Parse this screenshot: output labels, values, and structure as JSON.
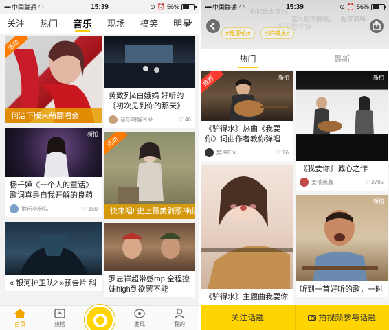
{
  "left": {
    "status": {
      "carrier": "中国联通",
      "time": "15:39",
      "battery": "56%",
      "battery_level": 0.56
    },
    "nav_tabs": [
      {
        "label": "关注",
        "active": false
      },
      {
        "label": "热门",
        "active": false
      },
      {
        "label": "音乐",
        "active": true
      },
      {
        "label": "现场",
        "active": false
      },
      {
        "label": "搞笑",
        "active": false
      },
      {
        "label": "明星",
        "active": false
      }
    ],
    "cards_col_a": [
      {
        "badge": "活动",
        "overlay": "何洁下版来萌翻唱会",
        "title": "",
        "author": "",
        "likes": ""
      },
      {
        "badge": "",
        "overlay": "",
        "title": "杨千嬅《一个人的童话》歌词真是自我开解的良药",
        "author": "港乐小分队",
        "likes": "150"
      },
      {
        "badge": "",
        "overlay": "",
        "title": "« 银河护卫队2 »预告片 科",
        "author": "",
        "likes": ""
      }
    ],
    "cards_col_b": [
      {
        "badge": "",
        "overlay": "",
        "title": "黄致列&白娥娟 好听的《初次见到你的那天》",
        "author": "音乐嗨醒耳朵",
        "likes": "46"
      },
      {
        "badge": "活动",
        "overlay": "快来唱! 史上最美剥葱神曲",
        "title": "",
        "author": "",
        "likes": ""
      },
      {
        "badge": "",
        "overlay": "",
        "title": "罗志祥超带感rap 全程撩妹high到欲罢不能",
        "author": "",
        "likes": ""
      }
    ],
    "tabbar": [
      {
        "label": "首页",
        "icon": "home-icon",
        "active": true
      },
      {
        "label": "热榜",
        "icon": "hot-list-icon",
        "active": false
      },
      {
        "label": "",
        "icon": "record-icon",
        "active": false
      },
      {
        "label": "发现",
        "icon": "discover-icon",
        "active": false
      },
      {
        "label": "我的",
        "icon": "profile-icon",
        "active": false
      }
    ]
  },
  "right": {
    "status": {
      "carrier": "中国联通",
      "time": "15:39",
      "battery": "56%",
      "battery_level": 0.56
    },
    "header": {
      "bg_line1": "你能给大家讨",
      "bg_line2": "这么暖的情歌，一起来演绎~",
      "title": "#我要你#",
      "tags": [
        "#我要你#",
        "#驴得水#"
      ]
    },
    "subtabs": [
      {
        "label": "热门",
        "active": true
      },
      {
        "label": "最新",
        "active": false
      }
    ],
    "cards_col_a": [
      {
        "badge": "推荐",
        "title": "《驴得水》热曲《我要你》词曲作者教你弹唱",
        "author": "樊冲Eric",
        "likes": "26"
      },
      {
        "badge": "",
        "title": "《驴得水》主题曲我要你",
        "author": "",
        "likes": ""
      }
    ],
    "cards_col_b": [
      {
        "badge": "",
        "title": "《我要你》诚心之作",
        "author": "姜楠燕鑫",
        "likes": "2785"
      },
      {
        "badge": "",
        "title": "听到一首好听的歌，一时",
        "author": "",
        "likes": ""
      }
    ],
    "watermark": "新拍",
    "actions": {
      "follow": "关注话题",
      "shoot": "拍视频参与话题"
    }
  }
}
